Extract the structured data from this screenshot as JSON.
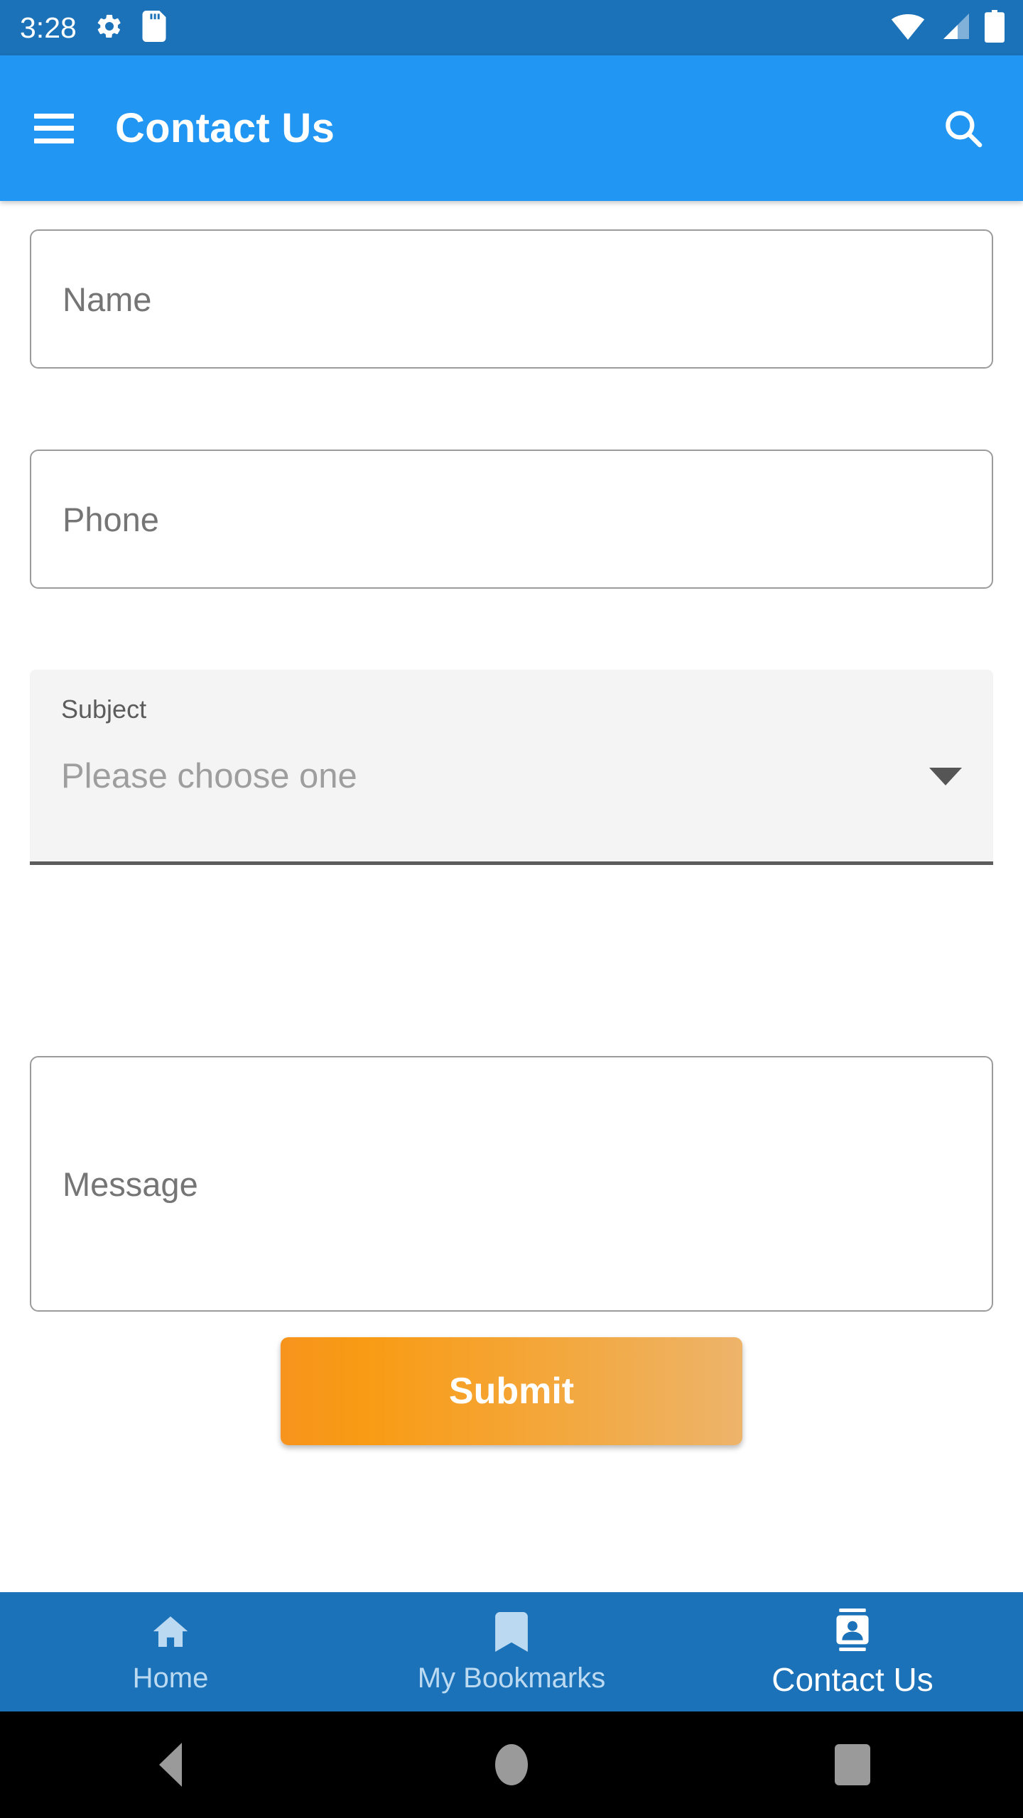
{
  "status_bar": {
    "time": "3:28",
    "icons": [
      "gear-icon",
      "sd-card-icon",
      "wifi-icon",
      "cellular-signal-icon",
      "battery-icon"
    ]
  },
  "app_bar": {
    "menu_icon": "hamburger-menu-icon",
    "title": "Contact Us",
    "search_icon": "search-icon"
  },
  "form": {
    "name": {
      "placeholder": "Name",
      "value": ""
    },
    "phone": {
      "placeholder": "Phone",
      "value": ""
    },
    "subject": {
      "label": "Subject",
      "selected": "Please choose one",
      "caret_icon": "chevron-down-icon"
    },
    "message": {
      "placeholder": "Message",
      "value": ""
    },
    "submit_label": "Submit"
  },
  "bottom_nav": {
    "items": [
      {
        "label": "Home",
        "icon": "home-icon",
        "active": false
      },
      {
        "label": "My Bookmarks",
        "icon": "bookmark-icon",
        "active": false
      },
      {
        "label": "Contact Us",
        "icon": "contact-card-icon",
        "active": true
      }
    ]
  },
  "system_nav": {
    "back": "back-triangle-icon",
    "home": "home-circle-icon",
    "recents": "recents-square-icon"
  },
  "colors": {
    "status_bar": "#1B72B8",
    "app_bar": "#2196F3",
    "accent_orange": "#F7941D",
    "nav_bar": "#1B72B8",
    "nav_inactive": "#BBDAF2"
  }
}
